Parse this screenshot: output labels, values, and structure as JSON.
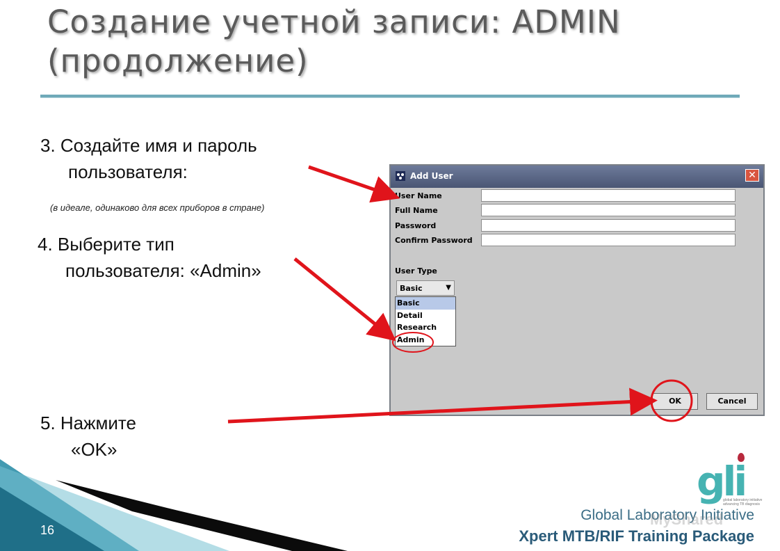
{
  "slide": {
    "title_line1": "Создание учетной записи: ADMIN",
    "title_line2": "(продолжение)",
    "page_number": "16"
  },
  "steps": {
    "step3_line1": "3. Создайте имя и пароль",
    "step3_line2": "пользователя:",
    "note": "(в идеале, одинаково для всех приборов в стране)",
    "step4_line1": "4. Выберите тип",
    "step4_line2": "пользователя: «Admin»",
    "step5_line1": "5. Нажмите",
    "step5_line2": "«OK»"
  },
  "dialog": {
    "title": "Add User",
    "close_glyph": "✕",
    "fields": [
      {
        "label": "User Name",
        "value": ""
      },
      {
        "label": "Full Name",
        "value": ""
      },
      {
        "label": "Password",
        "value": ""
      },
      {
        "label": "Confirm Password",
        "value": ""
      }
    ],
    "user_type_label": "User Type",
    "user_type_selected": "Basic",
    "user_type_options": [
      "Basic",
      "Detail",
      "Research",
      "Admin"
    ],
    "ok_label": "OK",
    "cancel_label": "Cancel"
  },
  "footer": {
    "logo_text": "gli",
    "logo_tagline": "global laboratory initiative advancing TB diagnosis",
    "org": "Global Laboratory Initiative",
    "package": "Xpert MTB/RIF Training Package",
    "watermark": "MyShared"
  },
  "colors": {
    "annotation_red": "#e0141b",
    "accent_teal": "#46b3b2",
    "footer_blue": "#2a5b79"
  }
}
